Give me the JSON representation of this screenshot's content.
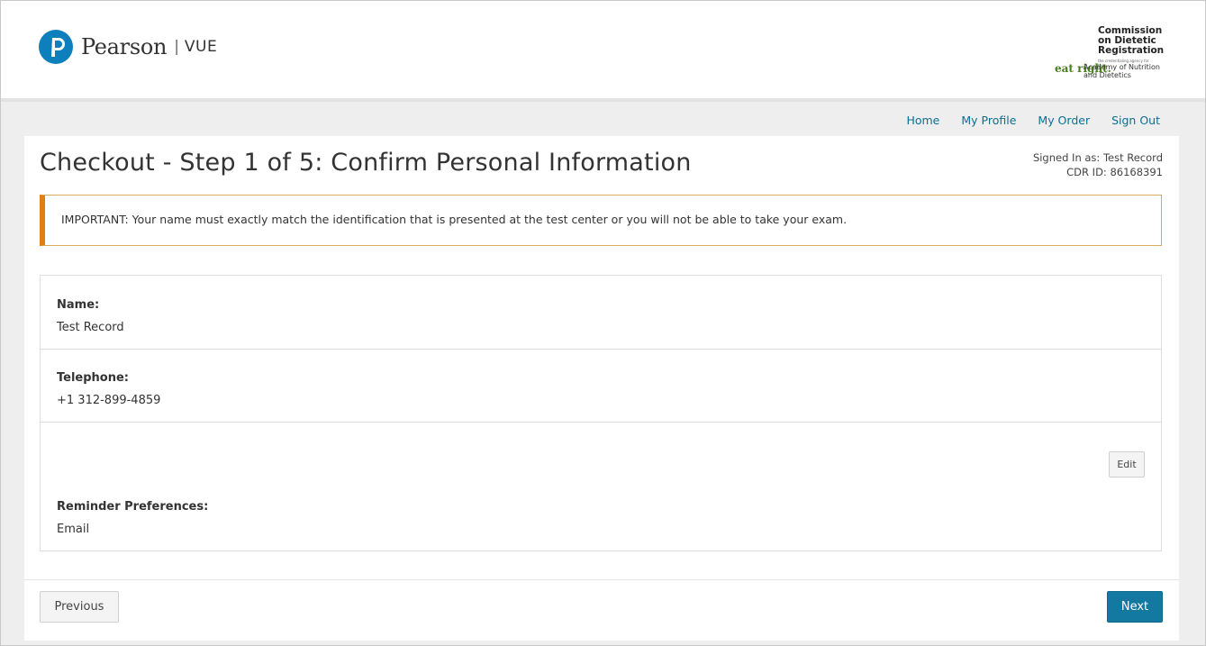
{
  "header": {
    "logo_word": "Pearson",
    "logo_separator": "|",
    "logo_product": "VUE",
    "partner": {
      "title_lines": [
        "Commission",
        "on Dietetic",
        "Registration"
      ],
      "tagline": "the credentialing agency for the",
      "eat_right": "eat right.",
      "academy_lines": [
        "Academy of Nutrition",
        "and Dietetics"
      ]
    }
  },
  "nav": {
    "items": [
      {
        "label": "Home"
      },
      {
        "label": "My Profile"
      },
      {
        "label": "My Order"
      },
      {
        "label": "Sign Out"
      }
    ]
  },
  "page": {
    "title": "Checkout - Step 1 of 5: Confirm Personal Information",
    "signed_in": "Signed In as: Test Record",
    "cdr_id": "CDR ID: 86168391",
    "alert": "IMPORTANT: Your name must exactly match the identification that is presented at the test center or you will not be able to take your exam."
  },
  "info": {
    "name_label": "Name:",
    "name_value": "Test Record",
    "phone_label": "Telephone:",
    "phone_value": "+1 312-899-4859",
    "reminder_label": "Reminder Preferences:",
    "reminder_value": "Email",
    "edit_label": "Edit"
  },
  "footer": {
    "previous_label": "Previous",
    "next_label": "Next"
  },
  "colors": {
    "brand_blue": "#0d7fbd",
    "link": "#0b6e94",
    "next_button": "#1379a0",
    "alert_accent": "#e07f12"
  }
}
